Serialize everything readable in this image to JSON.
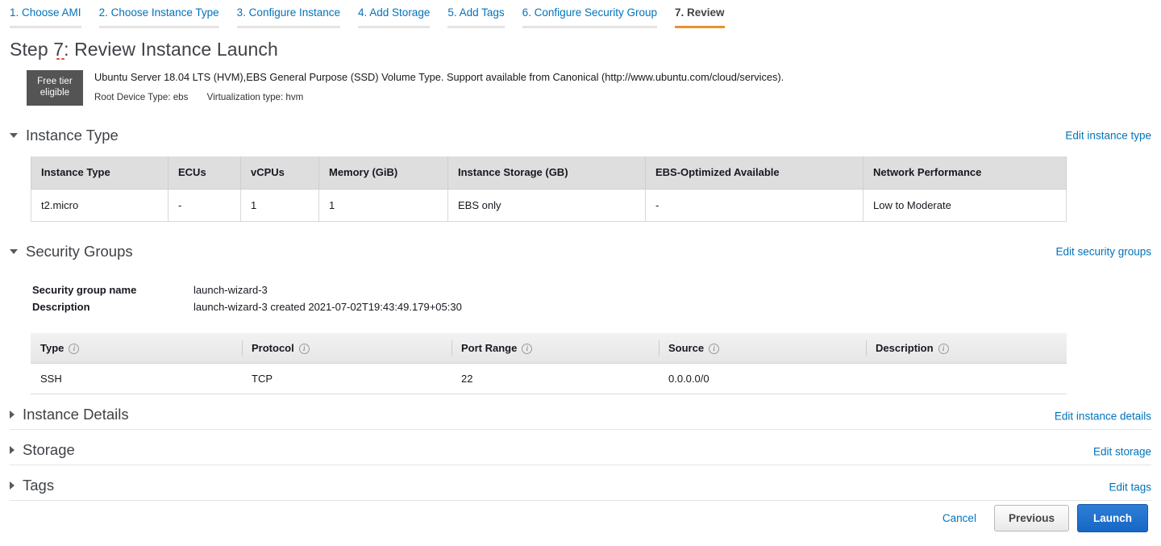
{
  "wizard": {
    "tabs": [
      {
        "label": "1. Choose AMI",
        "active": false
      },
      {
        "label": "2. Choose Instance Type",
        "active": false
      },
      {
        "label": "3. Configure Instance",
        "active": false
      },
      {
        "label": "4. Add Storage",
        "active": false
      },
      {
        "label": "5. Add Tags",
        "active": false
      },
      {
        "label": "6. Configure Security Group",
        "active": false
      },
      {
        "label": "7. Review",
        "active": true
      }
    ],
    "active_tab_color": "#ec912d",
    "link_color": "#0073bb"
  },
  "page_title": "Step 7: Review Instance Launch",
  "ami": {
    "badge_line1": "Free tier",
    "badge_line2": "eligible",
    "badge_bg": "#545454",
    "description": "Ubuntu Server 18.04 LTS (HVM),EBS General Purpose (SSD) Volume Type. Support available from Canonical (http://www.ubuntu.com/cloud/services).",
    "root_device_type": "Root Device Type: ebs",
    "virtualization_type": "Virtualization type: hvm"
  },
  "sections": {
    "instance_type": {
      "title": "Instance Type",
      "edit_label": "Edit instance type",
      "expanded": true,
      "table": {
        "headers": [
          "Instance Type",
          "ECUs",
          "vCPUs",
          "Memory (GiB)",
          "Instance Storage (GB)",
          "EBS-Optimized Available",
          "Network Performance"
        ],
        "rows": [
          [
            "t2.micro",
            "-",
            "1",
            "1",
            "EBS only",
            "-",
            "Low to Moderate"
          ]
        ]
      }
    },
    "security_groups": {
      "title": "Security Groups",
      "edit_label": "Edit security groups",
      "expanded": true,
      "name_label": "Security group name",
      "name_value": "launch-wizard-3",
      "description_label": "Description",
      "description_value": "launch-wizard-3 created 2021-07-02T19:43:49.179+05:30",
      "table": {
        "headers": [
          "Type",
          "Protocol",
          "Port Range",
          "Source",
          "Description"
        ],
        "header_info_icon": "info-icon",
        "rows": [
          [
            "SSH",
            "TCP",
            "22",
            "0.0.0.0/0",
            ""
          ]
        ]
      }
    },
    "instance_details": {
      "title": "Instance Details",
      "edit_label": "Edit instance details",
      "expanded": false
    },
    "storage": {
      "title": "Storage",
      "edit_label": "Edit storage",
      "expanded": false
    },
    "tags": {
      "title": "Tags",
      "edit_label": "Edit tags",
      "expanded": false
    }
  },
  "footer": {
    "cancel_label": "Cancel",
    "previous_label": "Previous",
    "launch_label": "Launch",
    "launch_color": "#1667c4"
  }
}
